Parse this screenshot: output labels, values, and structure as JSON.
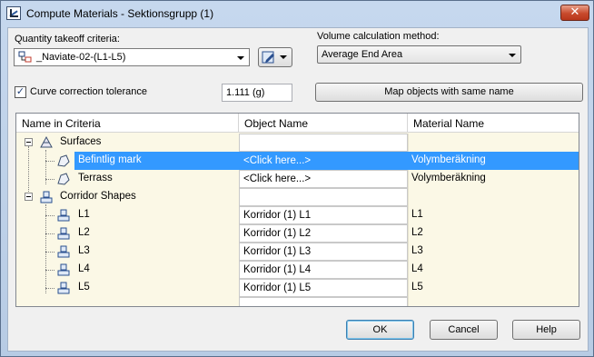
{
  "window": {
    "title": "Compute Materials - Sektionsgrupp (1)",
    "close_glyph": "✕"
  },
  "criteria": {
    "label": "Quantity takeoff criteria:",
    "value": "_Naviate-02-(L1-L5)"
  },
  "volume": {
    "label": "Volume calculation method:",
    "value": "Average End Area"
  },
  "curve": {
    "checked": true,
    "label": "Curve correction tolerance",
    "value": "1.111 (g)"
  },
  "map_button": "Map objects with same name",
  "grid": {
    "headers": [
      "Name in Criteria",
      "Object Name",
      "Material Name"
    ],
    "rows": [
      {
        "name": "Surfaces",
        "object": "",
        "material": ""
      },
      {
        "name": "Befintlig mark",
        "object": "<Click here...>",
        "material": "Volymberäkning"
      },
      {
        "name": "Terrass",
        "object": "<Click here...>",
        "material": "Volymberäkning"
      },
      {
        "name": "Corridor Shapes",
        "object": "",
        "material": ""
      },
      {
        "name": "L1",
        "object": "Korridor (1) L1",
        "material": "L1"
      },
      {
        "name": "L2",
        "object": "Korridor (1) L2",
        "material": "L2"
      },
      {
        "name": "L3",
        "object": "Korridor (1) L3",
        "material": "L3"
      },
      {
        "name": "L4",
        "object": "Korridor (1) L4",
        "material": "L4"
      },
      {
        "name": "L5",
        "object": "Korridor (1) L5",
        "material": "L5"
      }
    ]
  },
  "buttons": {
    "ok": "OK",
    "cancel": "Cancel",
    "help": "Help"
  },
  "colors": {
    "selection": "#3399ff",
    "grid_bg": "#fbf8e6"
  }
}
